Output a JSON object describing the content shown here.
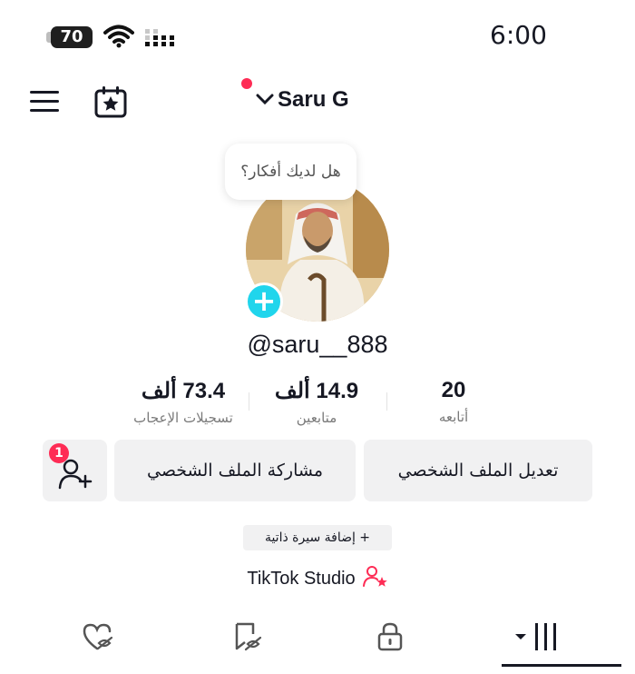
{
  "status_bar": {
    "battery": "70",
    "time": "6:00"
  },
  "header": {
    "account_name": "Saru G"
  },
  "profile": {
    "bubble_text": "هل لديك أفكار؟",
    "username": "@saru__888"
  },
  "stats": [
    {
      "value": "73.4 ألف",
      "label": "تسجيلات الإعجاب"
    },
    {
      "value": "14.9 ألف",
      "label": "متابعين"
    },
    {
      "value": "20",
      "label": "أتابعه"
    }
  ],
  "buttons": {
    "edit_profile": "تعديل الملف الشخصي",
    "share_profile": "مشاركة الملف الشخصي",
    "friend_badge": "1"
  },
  "bio_button": "+ إضافة سيرة ذاتية",
  "studio_label": "TikTok Studio",
  "colors": {
    "accent": "#fe2c55",
    "plus": "#20d5ec",
    "button_bg": "#f1f1f2"
  }
}
